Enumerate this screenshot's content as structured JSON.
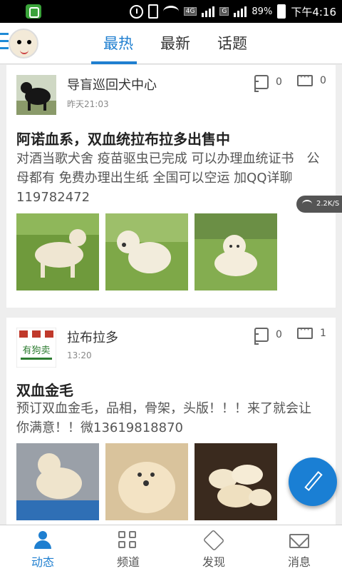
{
  "status_bar": {
    "network": "4G",
    "network_secondary": "G",
    "battery": "89%",
    "time": "下午4:16"
  },
  "nav": {
    "tabs": [
      {
        "label": "最热",
        "active": true
      },
      {
        "label": "最新",
        "active": false
      },
      {
        "label": "话题",
        "active": false
      }
    ]
  },
  "speed_indicator": "2.2K/S",
  "posts": [
    {
      "author": "导盲巡回犬中心",
      "time": "昨天21:03",
      "likes": "0",
      "comments": "0",
      "title": "阿诺血系，双血统拉布拉多出售中",
      "body": "对酒当歌犬舍 疫苗驱虫已完成 可以办理血统证书　公母都有 免费办理出生纸 全国可以空运 加QQ详聊 119782472",
      "photos": [
        "labrador-photo-1",
        "labrador-photo-2",
        "labrador-photo-3"
      ]
    },
    {
      "author": "拉布拉多",
      "time": "13:20",
      "likes": "0",
      "comments": "1",
      "avatar_text": "有狗卖",
      "title": "双血金毛",
      "body": "预订双血金毛，品相，骨架，头版！！！来了就会让你满意！！微13619818870",
      "photos": [
        "golden-photo-1",
        "golden-photo-2",
        "golden-photo-3"
      ]
    }
  ],
  "bottom_tabs": [
    {
      "label": "动态",
      "icon": "user-icon",
      "active": true
    },
    {
      "label": "频道",
      "icon": "grid-icon",
      "active": false
    },
    {
      "label": "发现",
      "icon": "compass-icon",
      "active": false
    },
    {
      "label": "消息",
      "icon": "mail-icon",
      "active": false
    }
  ],
  "colors": {
    "accent": "#1f7fd0",
    "fab": "#1a7fd4"
  }
}
